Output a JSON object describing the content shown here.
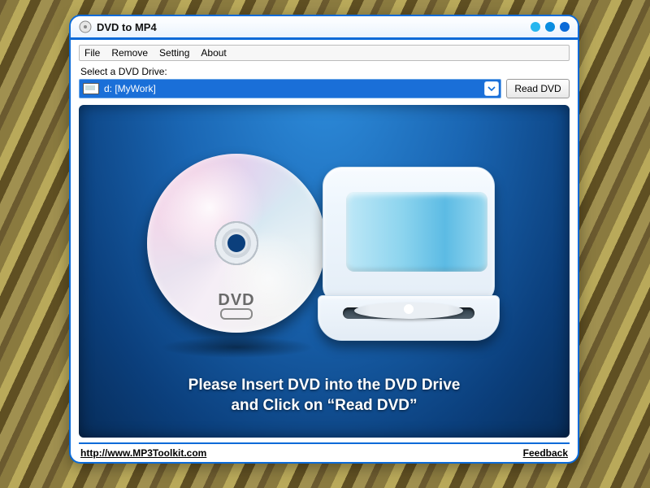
{
  "title": "DVD to MP4",
  "menu": {
    "file": "File",
    "remove": "Remove",
    "setting": "Setting",
    "about": "About"
  },
  "drive": {
    "label": "Select a DVD Drive:",
    "selected": "d: [MyWork]",
    "read_button": "Read DVD"
  },
  "preview": {
    "line1": "Please Insert DVD into the DVD Drive",
    "line2": "and Click on “Read DVD”",
    "disc_label": "DVD"
  },
  "footer": {
    "url": "http://www.MP3Toolkit.com",
    "feedback": "Feedback"
  }
}
